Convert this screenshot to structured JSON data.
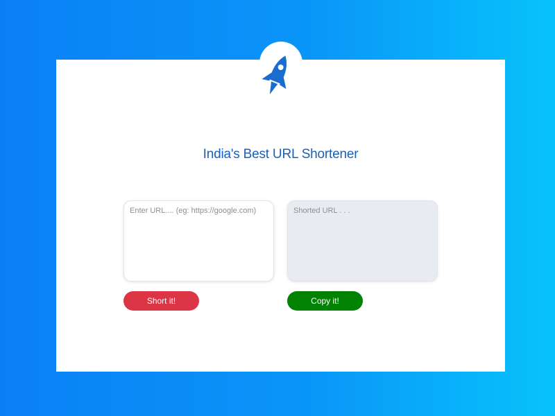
{
  "brand": {
    "logo_icon": "rocket-icon",
    "icon_color": "#1a6ccf"
  },
  "header": {
    "title": "India's Best URL Shortener"
  },
  "form": {
    "url_input": {
      "value": "",
      "placeholder": "Enter URL.... (eg: https://google.com)"
    },
    "short_output": {
      "value": "",
      "placeholder": "Shorted URL . . ."
    },
    "short_button_label": "Short it!",
    "copy_button_label": "Copy it!"
  },
  "colors": {
    "background_start": "#0a80f6",
    "background_end": "#08c2fb",
    "title": "#1a5fb8",
    "short_button": "#dc3545",
    "copy_button": "#028203",
    "output_background": "#e8ecf1"
  }
}
